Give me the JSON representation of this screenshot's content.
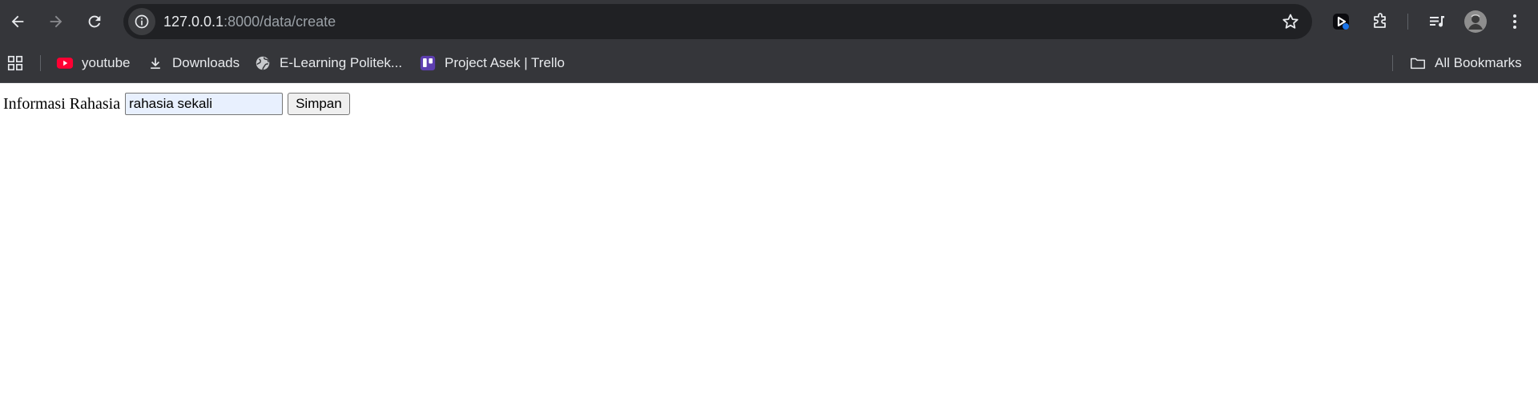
{
  "browser": {
    "url_host": "127.0.0.1",
    "url_path": ":8000/data/create"
  },
  "bookmarks": {
    "items": [
      {
        "label": "youtube",
        "icon": "youtube-icon"
      },
      {
        "label": "Downloads",
        "icon": "download-icon"
      },
      {
        "label": "E-Learning Politek...",
        "icon": "globe-icon"
      },
      {
        "label": "Project Asek | Trello",
        "icon": "trello-icon"
      }
    ],
    "all_bookmarks": "All Bookmarks"
  },
  "form": {
    "label": "Informasi Rahasia",
    "input_value": "rahasia sekali",
    "submit_label": "Simpan"
  },
  "colors": {
    "toolbar_bg": "#35363a",
    "omnibox_bg": "#202124",
    "youtube_red": "#ff0033",
    "trello_purple": "#5e3fb0",
    "autofill_bg": "#e8f0fe"
  }
}
